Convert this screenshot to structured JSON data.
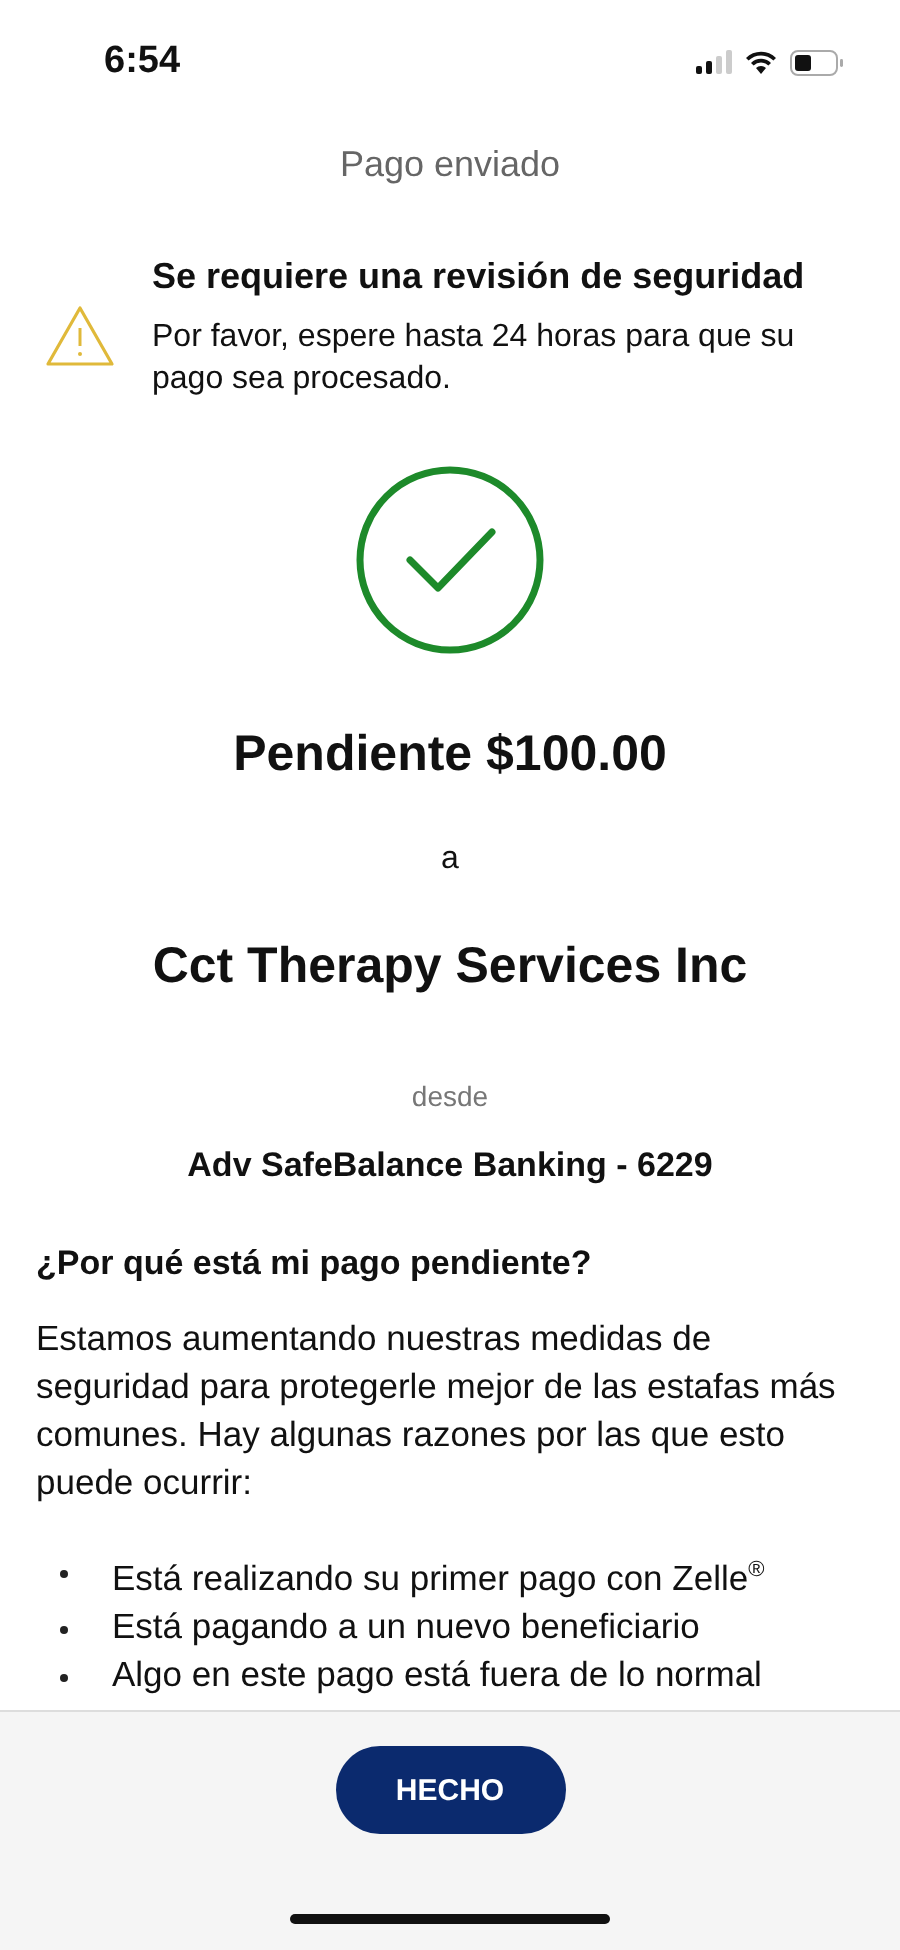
{
  "status_bar": {
    "time": "6:54"
  },
  "header": {
    "title": "Pago enviado"
  },
  "alert": {
    "title": "Se requiere una revisión de seguridad",
    "message": "Por favor, espere hasta 24 horas para que su pago sea procesado."
  },
  "payment": {
    "status_amount": "Pendiente $100.00",
    "to_label": "a",
    "recipient": "Cct Therapy Services Inc",
    "from_label": "desde",
    "account": "Adv SafeBalance Banking - 6229"
  },
  "info": {
    "question": "¿Por qué está mi pago pendiente?",
    "paragraph": "Estamos aumentando nuestras medidas de seguridad para protegerle mejor de las estafas más comunes. Hay algunas razones por las que esto puede ocurrir:",
    "reasons": [
      "Está realizando su primer pago con Zelle$^{®}$",
      "Está pagando a un nuevo beneficiario",
      "Algo en este pago está fuera de lo normal"
    ]
  },
  "footer": {
    "button": "HECHO"
  }
}
